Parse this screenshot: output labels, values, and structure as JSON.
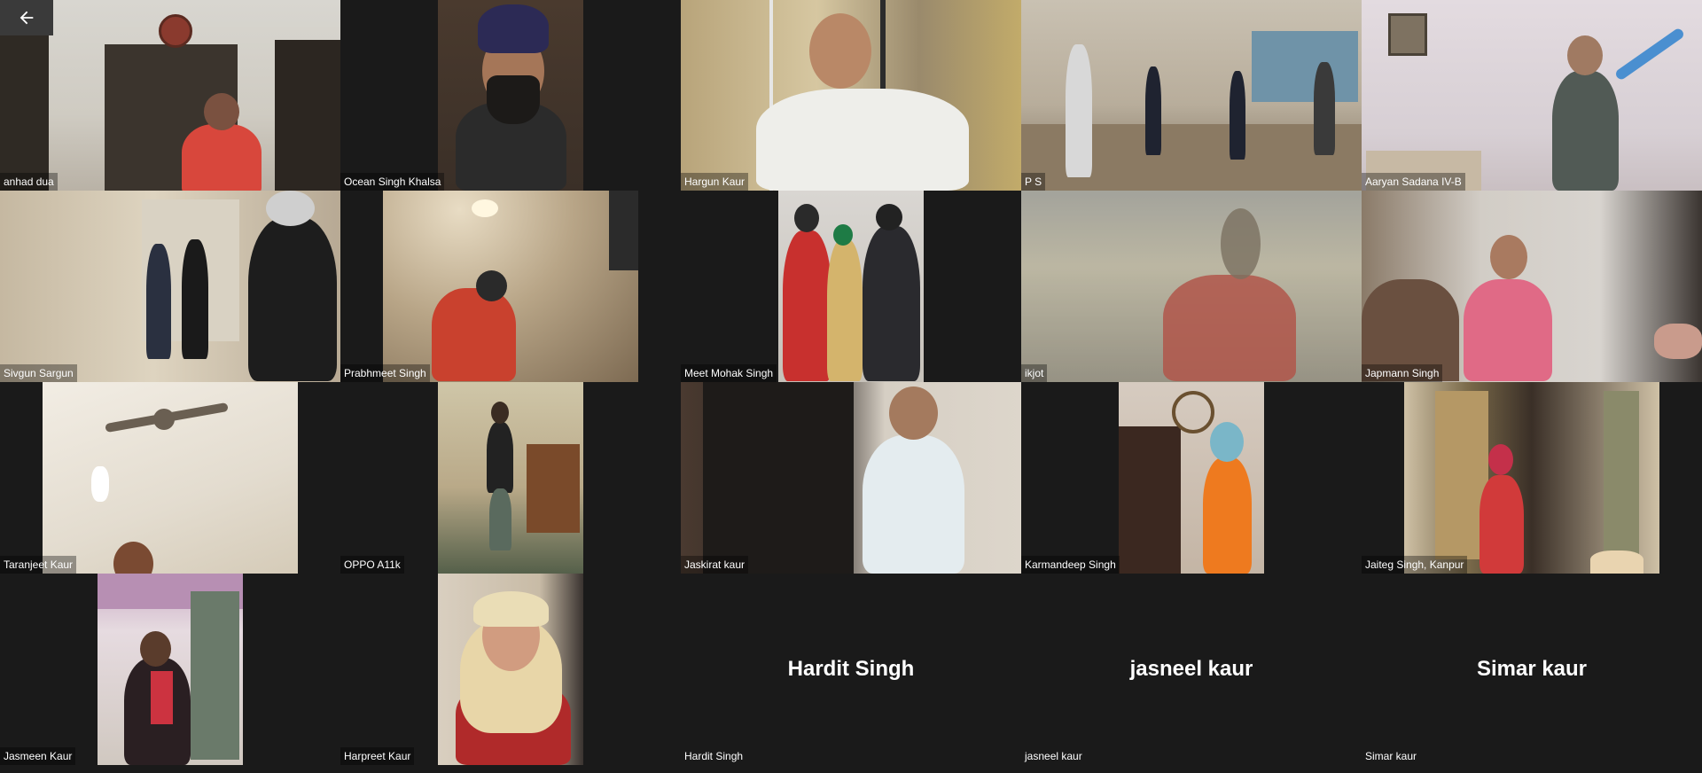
{
  "controls": {
    "back_icon": "arrow-left-icon"
  },
  "participants": [
    {
      "label": "anhad dua"
    },
    {
      "label": "Ocean Singh Khalsa"
    },
    {
      "label": "Hargun Kaur"
    },
    {
      "label": "P S"
    },
    {
      "label": "Aaryan Sadana IV-B"
    },
    {
      "label": "Sivgun Sargun"
    },
    {
      "label": "Prabhmeet Singh"
    },
    {
      "label": "Meet Mohak Singh"
    },
    {
      "label": "ikjot"
    },
    {
      "label": "Japmann Singh"
    },
    {
      "label": "Taranjeet Kaur"
    },
    {
      "label": "OPPO A11k"
    },
    {
      "label": "Jaskirat kaur"
    },
    {
      "label": "Karmandeep Singh"
    },
    {
      "label": "Jaiteg Singh, Kanpur"
    },
    {
      "label": "Jasmeen Kaur"
    },
    {
      "label": "Harpreet Kaur"
    },
    {
      "label": "Hardit Singh",
      "display": "Hardit Singh"
    },
    {
      "label": "jasneel kaur",
      "display": "jasneel kaur"
    },
    {
      "label": "Simar kaur",
      "display": "Simar kaur"
    }
  ]
}
